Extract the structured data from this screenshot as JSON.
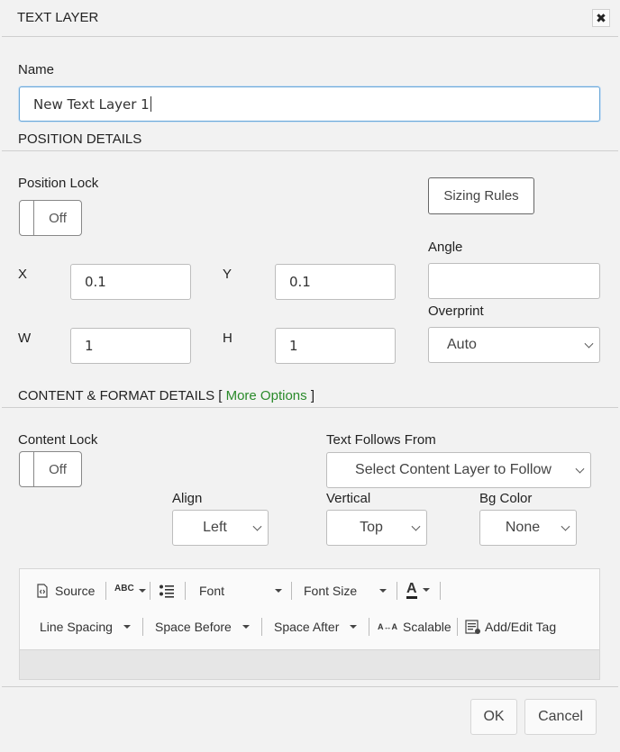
{
  "dialog": {
    "title": "TEXT LAYER",
    "close_glyph": "✖"
  },
  "name": {
    "label": "Name",
    "value": "New Text Layer 1"
  },
  "position": {
    "heading": "POSITION DETAILS",
    "lock_label": "Position Lock",
    "lock_state": "Off",
    "sizing_rules": "Sizing Rules",
    "angle_label": "Angle",
    "angle_value": "",
    "x_label": "X",
    "x_value": "0.1",
    "y_label": "Y",
    "y_value": "0.1",
    "w_label": "W",
    "w_value": "1",
    "h_label": "H",
    "h_value": "1",
    "overprint_label": "Overprint",
    "overprint_value": "Auto"
  },
  "content": {
    "heading": "CONTENT & FORMAT DETAILS [",
    "more_options": "More Options",
    "heading_close": "]",
    "lock_label": "Content Lock",
    "lock_state": "Off",
    "follows_label": "Text Follows From",
    "follows_value": "Select Content Layer to Follow",
    "align_label": "Align",
    "align_value": "Left",
    "vertical_label": "Vertical",
    "vertical_value": "Top",
    "bg_label": "Bg Color",
    "bg_value": "None"
  },
  "toolbar": {
    "source": "Source",
    "spell": "ABC",
    "font": "Font",
    "font_size": "Font Size",
    "font_color": "A",
    "line_spacing": "Line Spacing",
    "space_before": "Space Before",
    "space_after": "Space After",
    "scalable_icon": "A↔A",
    "scalable": "Scalable",
    "add_edit_tag": "Add/Edit Tag"
  },
  "footer": {
    "ok": "OK",
    "cancel": "Cancel"
  },
  "colors": {
    "link": "#2a8a2a",
    "focus": "#6aa7d8",
    "background": "#f2f2f2"
  }
}
